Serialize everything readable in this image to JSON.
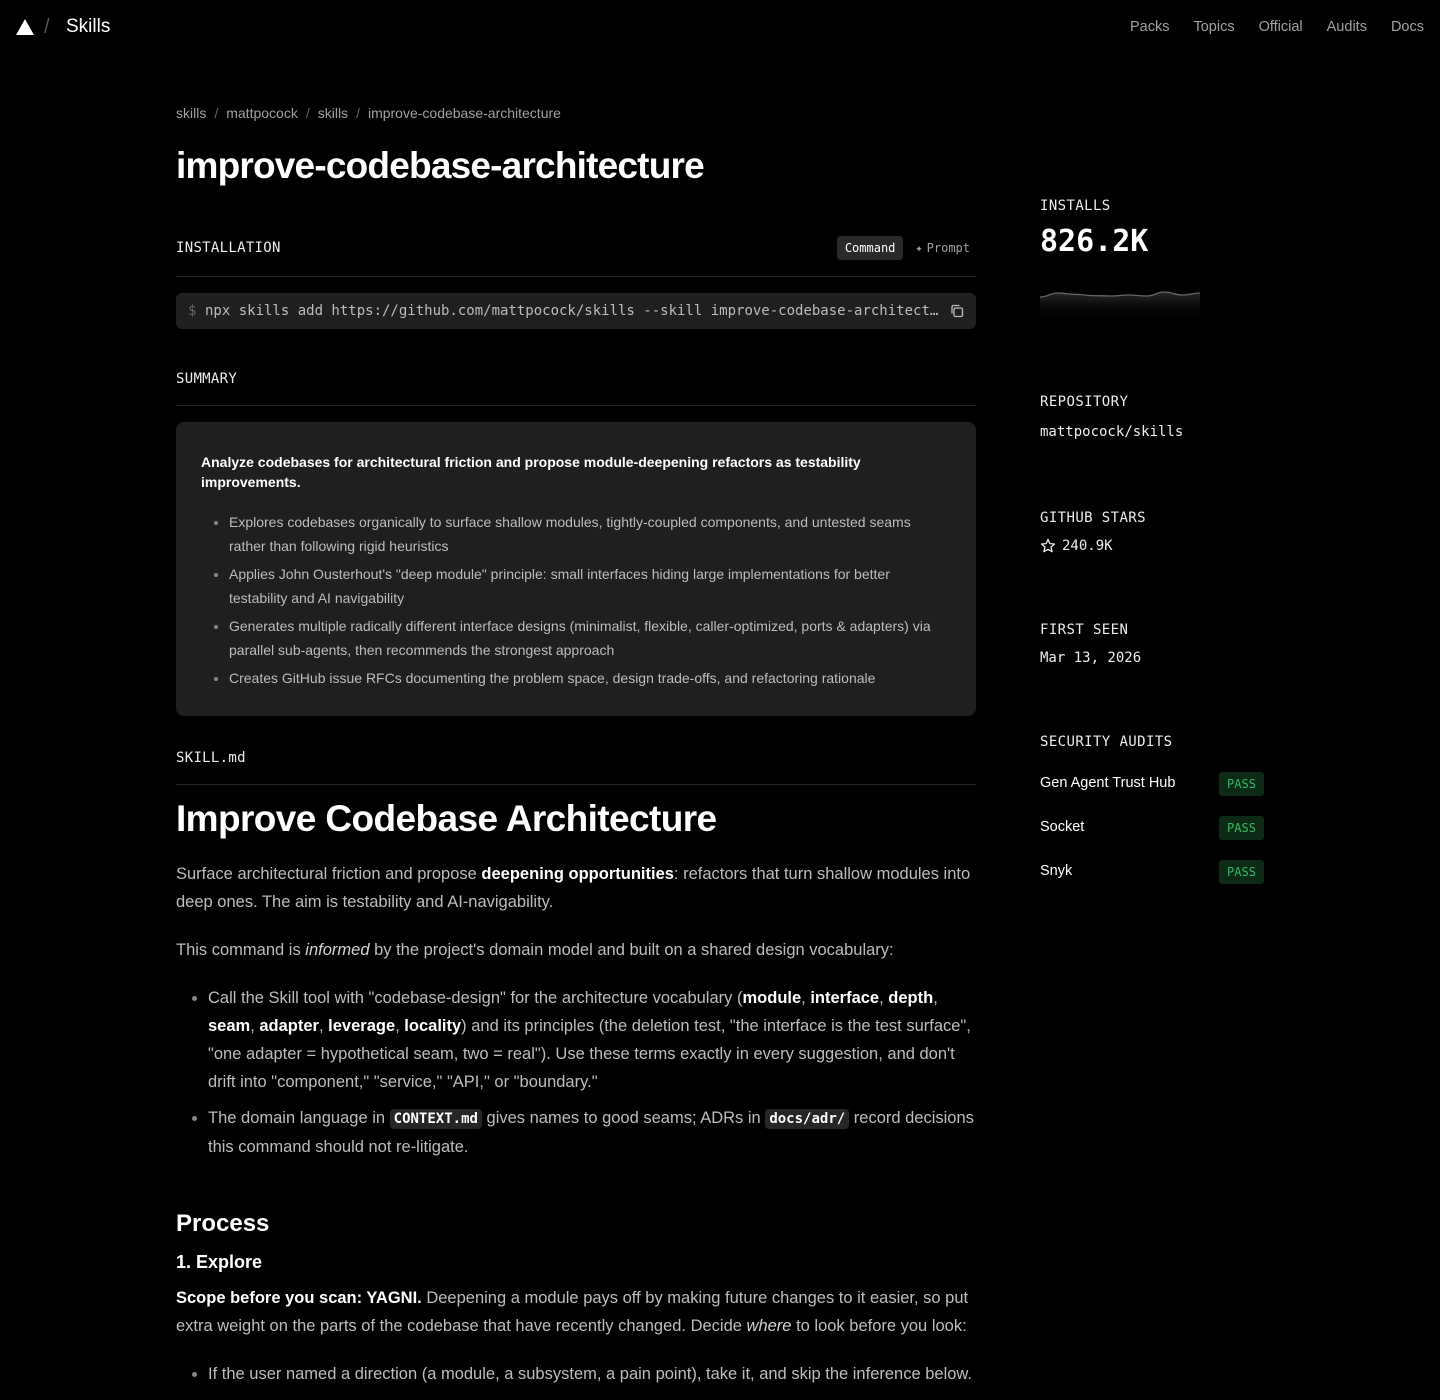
{
  "header": {
    "brand": "Skills",
    "nav": [
      "Packs",
      "Topics",
      "Official",
      "Audits",
      "Docs"
    ]
  },
  "breadcrumb": [
    "skills",
    "mattpocock",
    "skills",
    "improve-codebase-architecture"
  ],
  "title": "improve-codebase-architecture",
  "installation": {
    "label": "INSTALLATION",
    "tab_command": "Command",
    "tab_prompt": "Prompt",
    "prompt_symbol": "$",
    "command": "npx skills add https://github.com/mattpocock/skills --skill improve-codebase-architecture"
  },
  "summary": {
    "label": "SUMMARY",
    "lead": "Analyze codebases for architectural friction and propose module-deepening refactors as testability improvements.",
    "bullets": [
      "Explores codebases organically to surface shallow modules, tightly-coupled components, and untested seams rather than following rigid heuristics",
      "Applies John Ousterhout's \"deep module\" principle: small interfaces hiding large implementations for better testability and AI navigability",
      "Generates multiple radically different interface designs (minimalist, flexible, caller-optimized, ports & adapters) via parallel sub-agents, then recommends the strongest approach",
      "Creates GitHub issue RFCs documenting the problem space, design trade-offs, and refactoring rationale"
    ]
  },
  "skill_md": {
    "label": "SKILL.md",
    "heading": "Improve Codebase Architecture",
    "intro_a": "Surface architectural friction and propose ",
    "intro_b": "deepening opportunities",
    "intro_c": ": refactors that turn shallow modules into deep ones. The aim is testability and AI-navigability.",
    "informed_a": "This command is ",
    "informed_b": "informed",
    "informed_c": " by the project's domain model and built on a shared design vocabulary:",
    "b1_a": "Call the Skill tool with \"codebase-design\" for the architecture vocabulary (",
    "b1_terms": [
      "module",
      "interface",
      "depth",
      "seam",
      "adapter",
      "leverage",
      "locality"
    ],
    "b1_c": ") and its principles (the deletion test, \"the interface is the test surface\", \"one adapter = hypothetical seam, two = real\"). Use these terms exactly in every suggestion, and don't drift into \"component,\" \"service,\" \"API,\" or \"boundary.\"",
    "b2_a": "The domain language in ",
    "b2_code1": "CONTEXT.md",
    "b2_b": " gives names to good seams; ADRs in ",
    "b2_code2": "docs/adr/",
    "b2_c": " record decisions this command should not re-litigate.",
    "process": "Process",
    "explore": "1. Explore",
    "scope_bold": "Scope before you scan: YAGNI.",
    "scope_a": " Deepening a module pays off by making future changes to it easier, so put extra weight on the parts of the codebase that have recently changed. Decide ",
    "scope_em": "where",
    "scope_b": " to look before you look:",
    "last_bullet": "If the user named a direction (a module, a subsystem, a pain point), take it, and skip the inference below."
  },
  "sidebar": {
    "installs_label": "INSTALLS",
    "installs_value": "826.2K",
    "installs_trend": [
      0.55,
      0.35,
      0.42,
      0.48,
      0.5,
      0.45,
      0.5,
      0.3,
      0.45,
      0.35
    ],
    "repository_label": "REPOSITORY",
    "repository_value": "mattpocock/skills",
    "stars_label": "GITHUB STARS",
    "stars_value": "240.9K",
    "first_seen_label": "FIRST SEEN",
    "first_seen_value": "Mar 13, 2026",
    "audits_label": "SECURITY AUDITS",
    "audits": [
      {
        "name": "Gen Agent Trust Hub",
        "status": "PASS"
      },
      {
        "name": "Socket",
        "status": "PASS"
      },
      {
        "name": "Snyk",
        "status": "PASS"
      }
    ]
  }
}
